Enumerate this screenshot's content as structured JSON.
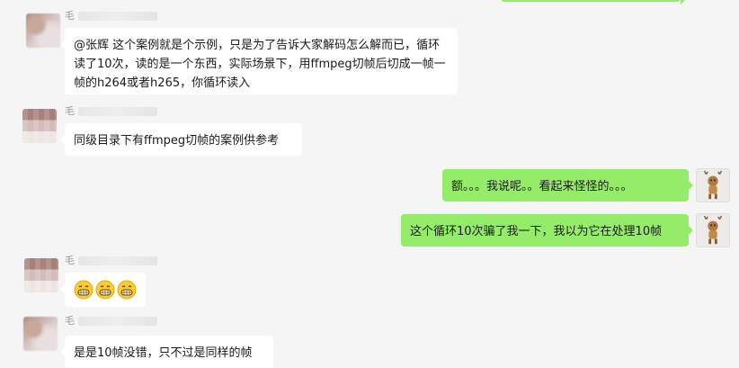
{
  "chat": {
    "sender_name": "毛",
    "messages": [
      {
        "id": "m1",
        "side": "left",
        "text": "@张辉 这个案例就是个示例，只是为了告诉大家解码怎么解而已，循环读了10次，读的是一个东西，实际场景下，用ffmpeg切帧后切成一帧一帧的h264或者h265，你循环读入"
      },
      {
        "id": "m2",
        "side": "left",
        "text": "同级目录下有ffmpeg切帧的案例供参考"
      },
      {
        "id": "m3",
        "side": "right",
        "text": "额。。。我说呢。。看起来怪怪的。。。"
      },
      {
        "id": "m4",
        "side": "right",
        "text": "这个循环10次骗了我一下，我以为它在处理10帧"
      },
      {
        "id": "m5",
        "side": "left",
        "emojis": [
          "grin-icon",
          "grin-icon",
          "grin-icon"
        ]
      },
      {
        "id": "m6",
        "side": "left",
        "text": "是是10帧没错，只不过是同样的帧"
      }
    ]
  },
  "colors": {
    "background": "#f5f5f5",
    "bubble_left": "#ffffff",
    "bubble_right": "#95ec69",
    "sender_name": "#999999"
  }
}
